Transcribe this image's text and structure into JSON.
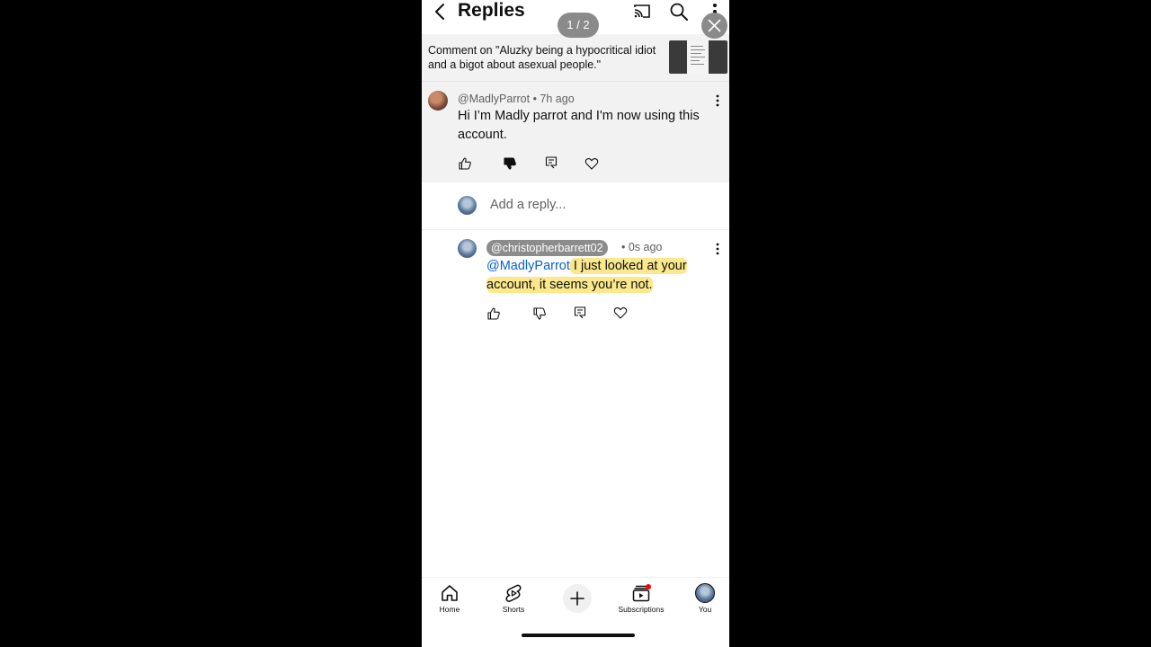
{
  "header": {
    "title": "Replies",
    "pager": "1 / 2"
  },
  "context": {
    "text": "Comment on \"Aluzky being a hypocritical idiot and a bigot about asexual people.\""
  },
  "parent_comment": {
    "handle": "@MadlyParrot",
    "time": "• 7h ago",
    "text": "Hi I’m Madly parrot and I'm now using this account."
  },
  "reply_box": {
    "placeholder": "Add a reply..."
  },
  "reply": {
    "handle": "@christopherbarrett02",
    "time": "• 0s ago",
    "mention": "@MadlyParrot",
    "text": " I just looked at your account, it seems you’re not."
  },
  "nav": {
    "items": [
      {
        "label": "Home",
        "icon": "home-icon"
      },
      {
        "label": "Shorts",
        "icon": "shorts-icon"
      },
      {
        "label": "",
        "icon": "plus-icon"
      },
      {
        "label": "Subscriptions",
        "icon": "subscriptions-icon"
      },
      {
        "label": "You",
        "icon": "avatar"
      }
    ]
  },
  "colors": {
    "highlight": "#fbe88c",
    "mention": "#065fd4",
    "notification_dot": "#ff0000"
  }
}
